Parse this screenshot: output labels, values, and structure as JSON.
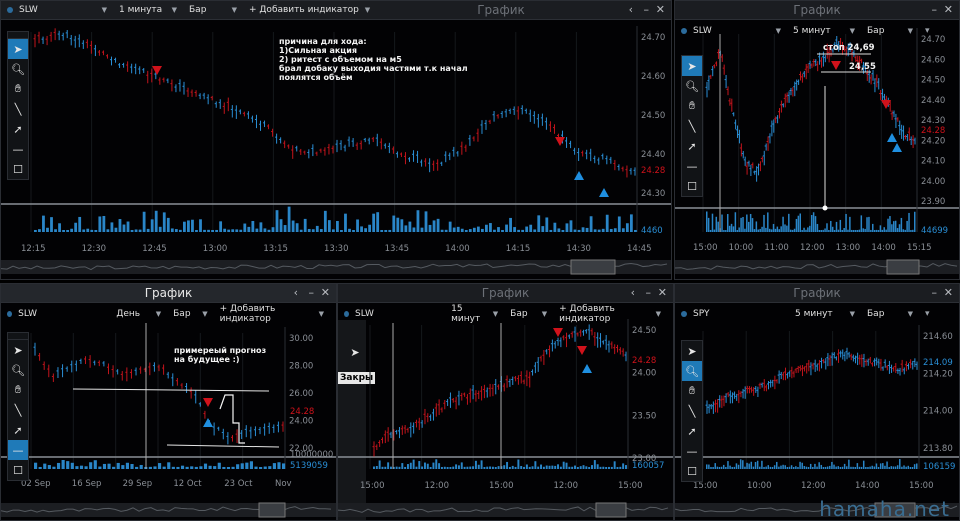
{
  "panels": {
    "top_left": {
      "toolbar": {
        "symbol": "SLW",
        "interval": "1 минута",
        "type": "Бар",
        "add": "+ Добавить индикатор"
      },
      "title": "График",
      "y_ticks": [
        "24.70",
        "24.60",
        "24.50",
        "24.40",
        "24.30"
      ],
      "price_red": "24.28",
      "vol_label": "4460",
      "x_ticks": [
        "12:15",
        "12:30",
        "12:45",
        "13:00",
        "13:15",
        "13:30",
        "13:45",
        "14:00",
        "14:15",
        "14:30",
        "14:45"
      ],
      "note": "причина для хода:\n1)Сильная акция\n2) ритест с объемом на м5\nбрал добаку выходия частями т.к начал\nпоялятся объём"
    },
    "top_right": {
      "title": "График",
      "toolbar": {
        "symbol": "SLW",
        "interval": "5 минут",
        "type": "Бар"
      },
      "y_ticks": [
        "24.70",
        "24.60",
        "24.50",
        "24.40",
        "24.30",
        "24.20",
        "24.10",
        "24.00",
        "23.90"
      ],
      "price_red": "24.28",
      "vol_label": "44699",
      "x_ticks": [
        "15:00",
        "10:00",
        "11:00",
        "12:00",
        "13:00",
        "14:00",
        "15:15"
      ],
      "label_stop": "стоп 24,69",
      "label_entry": "24,55"
    },
    "bottom_left": {
      "title": "График",
      "toolbar": {
        "symbol": "SLW",
        "interval": "День",
        "type": "Бар",
        "add": "+ Добавить индикатор"
      },
      "y_ticks": [
        "30.00",
        "28.00",
        "26.00",
        "24.00",
        "22.00"
      ],
      "price_red": "24.28",
      "vol_ticks": [
        "10000000",
        "5139059"
      ],
      "x_ticks": [
        "02 Sep",
        "16 Sep",
        "29 Sep",
        "12 Oct",
        "23 Oct",
        "Nov"
      ],
      "note": "примереый прогноз\nна будущее :)"
    },
    "bottom_mid": {
      "title": "График",
      "toolbar": {
        "symbol": "SLW",
        "interval": "15 минут",
        "type": "Бар",
        "add": "+ Добавить индикатор"
      },
      "y_ticks": [
        "24.50",
        "24.00",
        "23.50",
        "23.00"
      ],
      "price_red": "24.28",
      "vol_label": "160057",
      "x_ticks": [
        "15:00",
        "12:00",
        "15:00",
        "12:00",
        "15:00"
      ],
      "close_label": "Закры"
    },
    "bottom_right": {
      "title": "График",
      "toolbar": {
        "symbol": "SPY",
        "interval": "5 минут",
        "type": "Бар"
      },
      "y_ticks": [
        "214.60",
        "214.20",
        "214.00",
        "213.80"
      ],
      "price_blue": "214.09",
      "vol_label": "106159",
      "x_ticks": [
        "15:00",
        "10:00",
        "12:00",
        "14:00",
        "15:00"
      ]
    }
  },
  "controls": {
    "back": "‹",
    "min": "–",
    "close": "✕"
  },
  "icons": [
    "pointer-icon",
    "zoom-icon",
    "hand-icon",
    "line-icon",
    "arrow-icon",
    "hline-icon",
    "rect-icon"
  ],
  "watermark": "hamaha.net",
  "colors": {
    "up": "#2a8fd6",
    "down": "#c3141c",
    "bg": "#020204"
  }
}
